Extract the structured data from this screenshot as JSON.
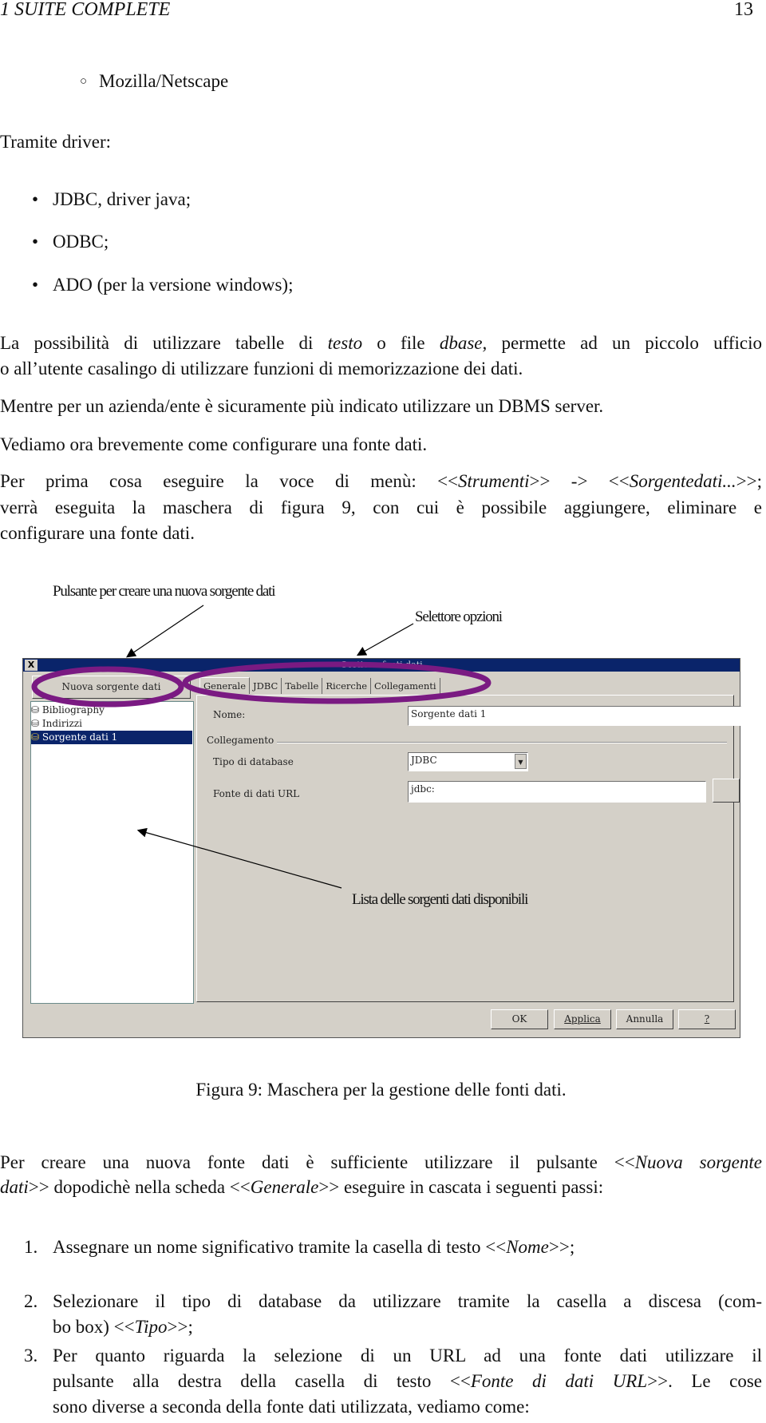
{
  "header": {
    "section": "1   SUITE COMPLETE",
    "page": "13"
  },
  "intro": {
    "sub_bullet": "Mozilla/Netscape",
    "drivers_label": "Tramite driver:",
    "bullets": [
      "JDBC, driver java;",
      "ODBC;",
      "ADO (per la versione windows);"
    ]
  },
  "paragraphs": [
    {
      "lines": [
        [
          {
            "t": "La possibilità di utilizzare tabelle di "
          },
          {
            "t": "testo",
            "i": true
          },
          {
            "t": " o file "
          },
          {
            "t": "dbase,",
            "i": true
          },
          {
            "t": " permette ad un piccolo ufficio"
          }
        ],
        [
          {
            "t": "o all’utente casalingo di utilizzare funzioni di memorizzazione dei dati."
          }
        ]
      ]
    },
    {
      "lines": [
        [
          {
            "t": "Mentre per un azienda/ente è sicuramente più indicato utilizzare un DBMS server."
          }
        ]
      ]
    },
    {
      "lines": [
        [
          {
            "t": "Vediamo ora brevemente come configurare una fonte dati."
          }
        ]
      ]
    },
    {
      "lines": [
        [
          {
            "t": "Per prima cosa eseguire la voce di menù: <<"
          },
          {
            "t": "Strumenti",
            "i": true
          },
          {
            "t": ">> -> <<"
          },
          {
            "t": "Sorgentedati...",
            "i": true
          },
          {
            "t": ">>;"
          }
        ],
        [
          {
            "t": "verrà eseguita la maschera di figura 9, con cui è possibile aggiungere, eliminare e"
          }
        ],
        [
          {
            "t": "configurare una fonte dati."
          }
        ]
      ]
    },
    {
      "lines": [
        [
          {
            "t": "Per creare una nuova fonte dati è sufficiente utilizzare il pulsante <<"
          },
          {
            "t": "Nuova sorgente",
            "i": true
          }
        ],
        [
          {
            "t": "dati",
            "i": true
          },
          {
            "t": ">> dopodichè nella scheda <<"
          },
          {
            "t": "Generale",
            "i": true
          },
          {
            "t": ">> eseguire in cascata i seguenti passi:"
          }
        ]
      ]
    }
  ],
  "figure": {
    "annotations": {
      "new_button": "Pulsante per creare una nuova sorgente dati",
      "tabs": "Selettore opzioni",
      "list": "Lista delle sorgenti dati disponibili"
    },
    "highlight_color": "#7a1a82",
    "dialog": {
      "title": "Gestione fonti dati",
      "close": "X",
      "new_button": "Nuova sorgente dati",
      "sources": [
        {
          "label": "Bibliography",
          "selected": false
        },
        {
          "label": "Indirizzi",
          "selected": false
        },
        {
          "label": "Sorgente dati 1",
          "selected": true
        }
      ],
      "tabs": [
        "Generale",
        "JDBC",
        "Tabelle",
        "Ricerche",
        "Collegamenti"
      ],
      "active_tab": "Generale",
      "name_label": "Nome:",
      "name_value": "Sorgente dati 1",
      "group_label": "Collegamento",
      "db_type_label": "Tipo di database",
      "db_type_value": "JDBC",
      "url_label": "Fonte di dati URL",
      "url_value": "jdbc:",
      "browse_button": "...",
      "buttons": {
        "ok": "OK",
        "apply": "Applica",
        "cancel": "Annulla",
        "help": "?"
      }
    },
    "caption": "Figura 9: Maschera per la gestione delle fonti dati."
  },
  "steps": [
    {
      "n": "1.",
      "lines": [
        [
          {
            "t": "Assegnare un nome significativo tramite la casella di testo <<"
          },
          {
            "t": "Nome",
            "i": true
          },
          {
            "t": ">>;"
          }
        ]
      ]
    },
    {
      "n": "2.",
      "lines": [
        [
          {
            "t": "Selezionare il tipo di database da utilizzare tramite la casella a discesa (com-"
          }
        ],
        [
          {
            "t": "bo box) <<"
          },
          {
            "t": "Tipo",
            "i": true
          },
          {
            "t": ">>;"
          }
        ]
      ]
    },
    {
      "n": "3.",
      "lines": [
        [
          {
            "t": "Per quanto riguarda la selezione di un URL ad una fonte dati utilizzare il"
          }
        ],
        [
          {
            "t": "pulsante alla destra della casella di testo <<"
          },
          {
            "t": "Fonte di dati URL",
            "i": true
          },
          {
            "t": ">>.  Le cose"
          }
        ],
        [
          {
            "t": "sono diverse a seconda della fonte dati utilizzata, vediamo come:"
          }
        ]
      ]
    }
  ]
}
